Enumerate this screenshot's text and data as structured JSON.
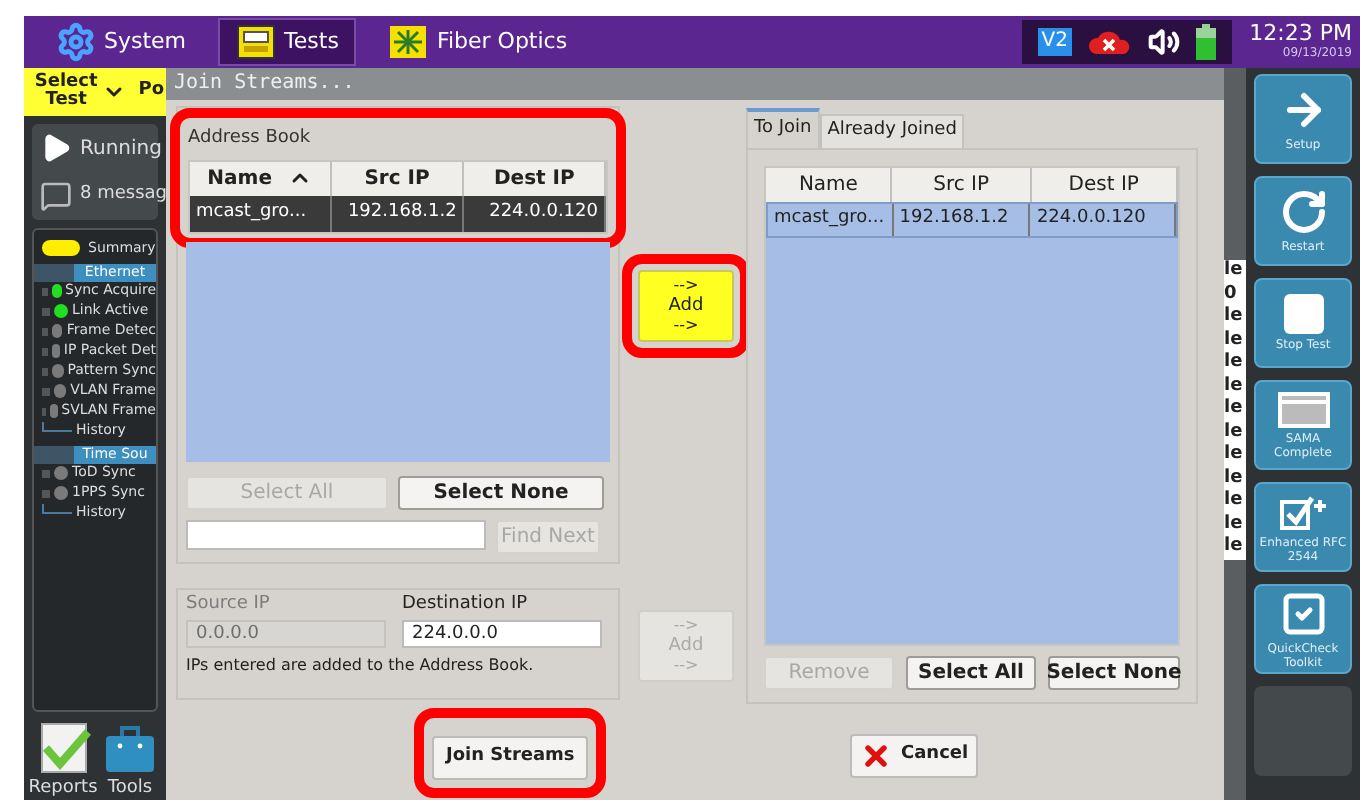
{
  "topbar": {
    "tabs": [
      {
        "label": "System",
        "kind": "gear",
        "selected": false
      },
      {
        "label": "Tests",
        "kind": "bert",
        "selected": true
      },
      {
        "label": "Fiber Optics",
        "kind": "fiber",
        "selected": false
      }
    ],
    "status": {
      "badge": "V2",
      "time": "12:23 PM",
      "date": "09/13/2019"
    }
  },
  "sidebar": {
    "select_test": "Select Test",
    "port_tab": "Po",
    "run_status": "Running",
    "messages": "8 messag",
    "summary": "Summary",
    "groups": [
      {
        "title": "Ethernet",
        "items": [
          {
            "label": "Sync Acquire",
            "kind": "indicator",
            "color": "#22dd22"
          },
          {
            "label": "Link Active",
            "kind": "indicator",
            "color": "#22dd22"
          },
          {
            "label": "Frame Detec",
            "kind": "indicator",
            "color": "#7a7a7a"
          },
          {
            "label": "IP Packet Det",
            "kind": "indicator",
            "color": "#7a7a7a"
          },
          {
            "label": "Pattern Sync",
            "kind": "indicator",
            "color": "#7a7a7a"
          },
          {
            "label": "VLAN Frame",
            "kind": "indicator",
            "color": "#7a7a7a"
          },
          {
            "label": "SVLAN Frame",
            "kind": "indicator",
            "color": "#7a7a7a"
          },
          {
            "label": "History",
            "kind": "link"
          }
        ]
      },
      {
        "title": "Time Sou",
        "items": [
          {
            "label": "ToD Sync",
            "kind": "indicator",
            "color": "#7a7a7a"
          },
          {
            "label": "1PPS Sync",
            "kind": "indicator",
            "color": "#7a7a7a"
          },
          {
            "label": "History",
            "kind": "link"
          }
        ]
      }
    ],
    "bottom": [
      {
        "label": "Reports",
        "kind": "reports"
      },
      {
        "label": "Tools",
        "kind": "tools"
      }
    ]
  },
  "dialog": {
    "title": "Join Streams...",
    "address_book": {
      "title": "Address Book",
      "highlighted": true,
      "focused": true,
      "columns": [
        {
          "label": "Name",
          "sorted": true
        },
        {
          "label": "Src IP",
          "sorted": false
        },
        {
          "label": "Dest IP",
          "sorted": false
        }
      ],
      "rows": [
        {
          "cells": [
            "mcast_gro...",
            "192.168.1.2",
            "224.0.0.120"
          ],
          "selected": true
        }
      ],
      "buttons": [
        {
          "label": "Select All",
          "disabled": true
        },
        {
          "label": "Select None",
          "disabled": false
        }
      ],
      "find_button": {
        "label": "Find Next",
        "disabled": true
      }
    },
    "add_buttons": [
      {
        "arrow_top": "-->",
        "label": "Add",
        "arrow_bottom": "-->",
        "disabled": false,
        "highlighted": true
      },
      {
        "arrow_top": "-->",
        "label": "Add",
        "arrow_bottom": "-->",
        "disabled": true,
        "highlighted": false
      }
    ],
    "manual_entry": {
      "fields": [
        {
          "label": "Source IP",
          "value": "0.0.0.0",
          "disabled": true
        },
        {
          "label": "Destination IP",
          "value": "224.0.0.0",
          "disabled": false
        }
      ],
      "note": "IPs entered are added to the Address Book."
    },
    "streams": {
      "tabs": [
        {
          "label": "To Join",
          "selected": true
        },
        {
          "label": "Already Joined",
          "selected": false
        }
      ],
      "focused": false,
      "columns": [
        {
          "label": "Name",
          "sorted": false
        },
        {
          "label": "Src IP",
          "sorted": false
        },
        {
          "label": "Dest IP",
          "sorted": false
        }
      ],
      "rows": [
        {
          "cells": [
            "mcast_gro...",
            "192.168.1.2",
            "224.0.0.120"
          ],
          "selected": true
        }
      ],
      "buttons": [
        {
          "label": "Remove",
          "disabled": true
        },
        {
          "label": "Select All",
          "disabled": false
        },
        {
          "label": "Select None",
          "disabled": false
        }
      ]
    },
    "join_button": {
      "label": "Join Streams",
      "highlighted": true
    },
    "cancel_button": {
      "label": "Cancel"
    }
  },
  "background_column": [
    "le",
    "0",
    "le",
    "le",
    "le",
    "le",
    "le",
    "le",
    "le",
    "le",
    "le",
    "le",
    "le"
  ],
  "side_buttons": [
    {
      "label": "Setup",
      "kind": "arrow"
    },
    {
      "label": "Restart",
      "kind": "restart"
    },
    {
      "label": "Stop Test",
      "kind": "stop"
    },
    {
      "label": "SAMA Complete",
      "kind": "window"
    },
    {
      "label": "Enhanced RFC 2544",
      "kind": "checkplus"
    },
    {
      "label": "QuickCheck Toolkit",
      "kind": "check"
    },
    {
      "kind": "empty"
    }
  ]
}
